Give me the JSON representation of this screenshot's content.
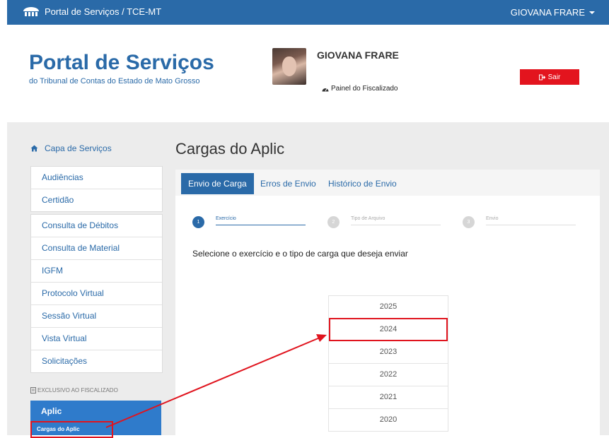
{
  "topbar": {
    "brand": "Portal de Serviços / TCE-MT",
    "user": "GIOVANA FRARE"
  },
  "header": {
    "title": "Portal de Serviços",
    "subtitle": "do Tribunal de Contas do Estado de Mato Grosso",
    "user_name": "GIOVANA FRARE",
    "panel_link": "Painel do Fiscalizado",
    "logout": "Sair"
  },
  "sidebar": {
    "home": "Capa de Serviços",
    "group1": [
      "Audiências",
      "Certidão"
    ],
    "group2": [
      "Consulta de Débitos",
      "Consulta de Material",
      "IGFM",
      "Protocolo Virtual",
      "Sessão Virtual",
      "Vista Virtual",
      "Solicitações"
    ],
    "exclusive": "EXCLUSIVO AO FISCALIZADO",
    "aplic": "Aplic",
    "aplic_sub": "Cargas do Aplic"
  },
  "content": {
    "title": "Cargas do Aplic",
    "tabs": [
      "Envio de Carga",
      "Erros de Envio",
      "Histórico de Envio"
    ],
    "steps": [
      {
        "num": "1",
        "label": "Exercício"
      },
      {
        "num": "2",
        "label": "Tipo de Arquivo"
      },
      {
        "num": "3",
        "label": "Envio"
      }
    ],
    "instruction": "Selecione o exercício e o tipo de carga que deseja enviar",
    "years": [
      "2025",
      "2024",
      "2023",
      "2022",
      "2021",
      "2020"
    ]
  },
  "colors": {
    "primary": "#2a6aa8",
    "danger": "#e3141e",
    "highlight": "#e0141e"
  }
}
